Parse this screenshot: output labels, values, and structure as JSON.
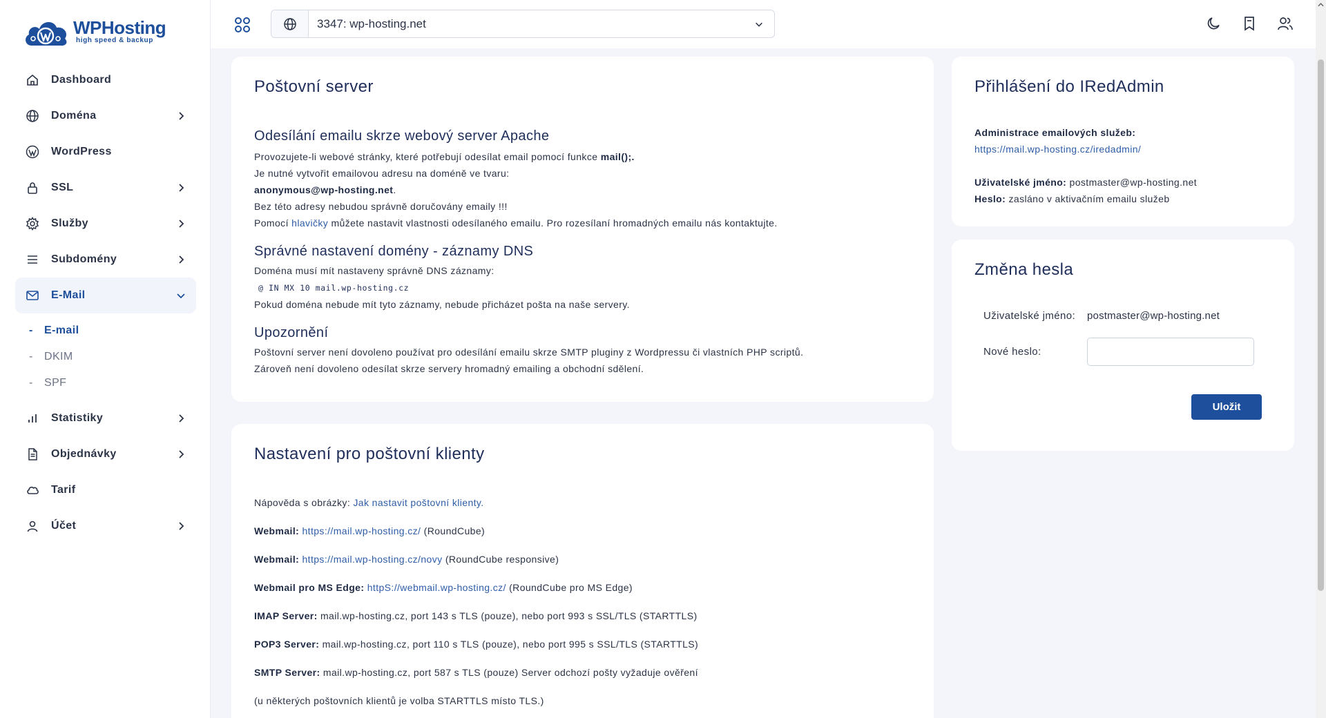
{
  "brand": {
    "name": "WPHosting",
    "tagline": "high speed & backup"
  },
  "sidebar": {
    "items": [
      {
        "label": "Dashboard",
        "icon": "home-icon"
      },
      {
        "label": "Doména",
        "icon": "globe-icon"
      },
      {
        "label": "WordPress",
        "icon": "wordpress-icon"
      },
      {
        "label": "SSL",
        "icon": "lock-icon"
      },
      {
        "label": "Služby",
        "icon": "gear-icon"
      },
      {
        "label": "Subdomény",
        "icon": "menu-lines-icon"
      },
      {
        "label": "E-Mail",
        "icon": "mail-icon"
      },
      {
        "label": "Statistiky",
        "icon": "bar-chart-icon"
      },
      {
        "label": "Objednávky",
        "icon": "document-icon"
      },
      {
        "label": "Tarif",
        "icon": "cloud-icon"
      },
      {
        "label": "Účet",
        "icon": "user-icon"
      }
    ],
    "email_sub": [
      "E-mail",
      "DKIM",
      "SPF"
    ],
    "dash": "-"
  },
  "topbar": {
    "domain": "3347: wp-hosting.net"
  },
  "mail_server": {
    "title": "Poštovní server",
    "s1_title": "Odesílání emailu skrze webový server Apache",
    "s1_l1": "Provozujete-li webové stránky, které potřebují odesílat email pomocí funkce ",
    "s1_l1_b": "mail();.",
    "s1_l2": "Je nutné vytvořit emailovou adresu na doméně ve tvaru:",
    "s1_l3_b": "anonymous@wp-hosting.net",
    "s1_l3_end": ".",
    "s1_l4": "Bez této adresy nebudou správně doručovány emaily !!!",
    "s1_l5_a": "Pomocí ",
    "s1_l5_link": "hlavičky",
    "s1_l5_b": " můžete nastavit vlastnosti odesílaného emailu. Pro rozesílaní hromadných emailu nás kontaktujte.",
    "s2_title": "Správné nastavení domény - záznamy DNS",
    "s2_l1": "Doména musí mít nastaveny správně DNS záznamy:",
    "s2_code": "@ IN MX 10 mail.wp-hosting.cz",
    "s2_l2": "Pokud doména nebude mít tyto záznamy, nebude přicházet pošta na naše servery.",
    "s3_title": "Upozornění",
    "s3_l1": "Poštovní server není dovoleno používat pro odesílání emailu skrze SMTP pluginy z Wordpressu či vlastních PHP scriptů.",
    "s3_l2": "Zároveň není dovoleno odesílat skrze servery hromadný emailing a obchodní sdělení."
  },
  "clients": {
    "title": "Nastavení pro poštovní klienty",
    "help_text": "Nápověda s obrázky: ",
    "help_link": "Jak nastavit poštovní klienty.",
    "rows": [
      {
        "label": "Webmail:",
        "link": "https://mail.wp-hosting.cz/",
        "text": " (RoundCube)"
      },
      {
        "label": "Webmail:",
        "link": "https://mail.wp-hosting.cz/novy",
        "text": " (RoundCube responsive)"
      },
      {
        "label": "Webmail pro MS Edge:",
        "link": "httpS://webmail.wp-hosting.cz/",
        "text": " (RoundCube pro MS Edge)"
      },
      {
        "label": "IMAP Server:",
        "text": " mail.wp-hosting.cz, port 143 s TLS (pouze), nebo port 993 s SSL/TLS (STARTTLS)"
      },
      {
        "label": "POP3 Server:",
        "text": " mail.wp-hosting.cz, port 110 s TLS (pouze), nebo port 995 s SSL/TLS (STARTTLS)"
      },
      {
        "label": "SMTP Server:",
        "text": " mail.wp-hosting.cz, port 587 s TLS (pouze) Server odchozí pošty vyžaduje ověření"
      }
    ],
    "note": "(u některých poštovních klientů je volba STARTTLS místo TLS.)"
  },
  "iredadmin": {
    "title": "Přihlášení do IRedAdmin",
    "admin_label": "Administrace emailových služeb:",
    "admin_link": "https://mail.wp-hosting.cz/iredadmin/",
    "user_label": "Uživatelské jméno:",
    "user_value": " postmaster@wp-hosting.net",
    "pass_label": "Heslo:",
    "pass_value": " zasláno v aktivačním emailu služeb"
  },
  "password_change": {
    "title": "Změna hesla",
    "user_label": "Uživatelské jméno:",
    "user_value": "postmaster@wp-hosting.net",
    "new_pass_label": "Nové heslo:",
    "new_pass_value": "",
    "save_label": "Uložit"
  },
  "colors": {
    "brand": "#1d4f9c",
    "link": "#2f5da8",
    "heading": "#1f2e5a",
    "background": "#f3f5fb"
  }
}
